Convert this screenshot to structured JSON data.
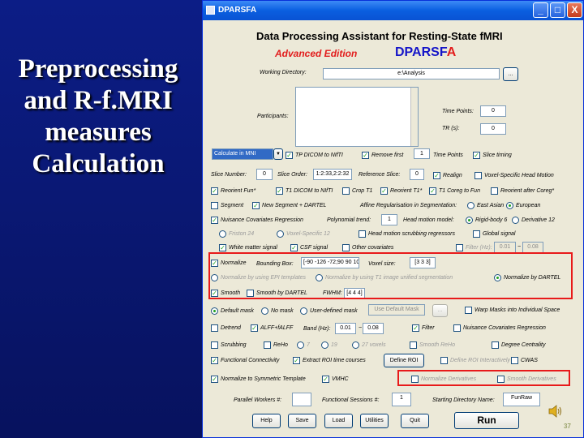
{
  "slide": {
    "title_lines": [
      "Preprocessing",
      "and R-f.MRI",
      "measures",
      "Calculation"
    ]
  },
  "window": {
    "title": "DPARSFA",
    "min": "_",
    "max": "□",
    "close": "X"
  },
  "header": {
    "title": "Data Processing Assistant for Resting-State fMRI",
    "edition": "Advanced Edition",
    "logo_main": "DPARSF",
    "logo_accent": "A"
  },
  "working_dir": {
    "label": "Working Directory:",
    "value": "e:\\Analysis",
    "browse": "..."
  },
  "participants": {
    "label": "Participants:"
  },
  "time_points": {
    "label": "Time Points:",
    "value": "0"
  },
  "tr": {
    "label": "TR (s):",
    "value": "0"
  },
  "row1": {
    "space_select": "Calculate in MNI",
    "tp_dicom": "TP DICOM to NIfTI",
    "remove_first": "Remove first",
    "remove_value": "1",
    "time_points": "Time Points",
    "slice_timing": "Slice timing"
  },
  "row2": {
    "slice_number_label": "Slice Number:",
    "slice_number": "0",
    "slice_order_label": "Slice Order:",
    "slice_order": "1:2:33,2:2:32",
    "reference_slice_label": "Reference Slice:",
    "reference_slice": "0",
    "realign": "Realign",
    "voxel_specific": "Voxel-Specific Head Motion"
  },
  "row3": {
    "reorient_fun": "Reorient Fun*",
    "t1_dicom": "T1 DICOM to NIfTI",
    "crop_t1": "Crop T1",
    "reorient_t1": "Reorient T1*",
    "t1_coreg": "T1 Coreg to Fun",
    "reorient_after": "Reorient after Coreg*"
  },
  "row4": {
    "segment": "Segment",
    "new_segment": "New Segment + DARTEL",
    "affine_label": "Affine Regularisation in Segmentation:",
    "east_asian": "East Asian",
    "european": "European"
  },
  "row5": {
    "nuisance": "Nuisance Covariates Regression",
    "polynomial_label": "Polynomial trend:",
    "polynomial_value": "1",
    "head_motion_label": "Head motion model:",
    "rigid_body": "Rigid-body 6",
    "derivative12": "Derivative 12"
  },
  "row6": {
    "friston24": "Friston 24",
    "voxel_specific12": "Voxel-Specific 12",
    "head_motion_scrub": "Head motion scrubbing regressors",
    "global_signal": "Global signal"
  },
  "row7": {
    "white_matter": "White matter signal",
    "csf": "CSF signal",
    "other_cov": "Other covariates",
    "filter": "Filter (Hz):",
    "filter_low": "0.01",
    "filter_tilde": "~",
    "filter_high": "0.08"
  },
  "row8": {
    "normalize": "Normalize",
    "bbox_label": "Bounding Box:",
    "bbox_value": "[-90 -126 -72;90 90 108]",
    "voxel_label": "Voxel size:",
    "voxel_value": "[3 3 3]"
  },
  "row9": {
    "norm_epi": "Normalize by using EPI templates",
    "norm_t1": "Normalize by using T1 image unified segmentation",
    "norm_dartel": "Normalize by DARTEL"
  },
  "row10": {
    "smooth": "Smooth",
    "smooth_dartel": "Smooth by DARTEL",
    "fwhm_label": "FWHM:",
    "fwhm_value": "[4 4 4]"
  },
  "row11": {
    "default_mask": "Default mask",
    "no_mask": "No mask",
    "user_mask": "User-defined mask",
    "use_default": "Use Default Mask",
    "browse": "...",
    "warp_masks": "Warp Masks into Individual Space"
  },
  "row12": {
    "detrend": "Detrend",
    "alff": "ALFF+fALFF",
    "band_label": "Band (Hz):",
    "band_low": "0.01",
    "band_tilde": "~",
    "band_high": "0.08",
    "filter": "Filter",
    "nuisance2": "Nuisance Covariates Regression"
  },
  "row13": {
    "scrubbing": "Scrubbing",
    "reho": "ReHo",
    "r7": "7",
    "r19": "19",
    "r27": "27 voxels",
    "smooth_reho": "Smooth ReHo",
    "degree": "Degree Centrality"
  },
  "row14": {
    "fc": "Functional Connectivity",
    "extract_roi": "Extract ROI time courses",
    "define_roi": "Define ROI",
    "define_roi_int": "Define ROI Interactively",
    "vmhc_pre": "CWAS"
  },
  "row15": {
    "normalize_sym": "Normalize to Symmetric Template",
    "vmhc": "VMHC",
    "normalize_deriv": "Normalize Derivatives",
    "smooth_deriv": "Smooth Derivatives"
  },
  "row16": {
    "parallel_label": "Parallel Workers #:",
    "parallel_value": "",
    "sessions_label": "Functional Sessions #:",
    "sessions_value": "1",
    "start_dir_label": "Starting Directory Name:",
    "start_dir_value": "FunRaw"
  },
  "buttons": {
    "help": "Help",
    "save": "Save",
    "load": "Load",
    "utilities": "Utilities",
    "quit": "Quit",
    "run": "Run"
  },
  "page_number": "37",
  "colors": {
    "accent_red": "#e81a1a",
    "slide_bg": "#0c1d86",
    "logo_blue": "#1515c8"
  }
}
